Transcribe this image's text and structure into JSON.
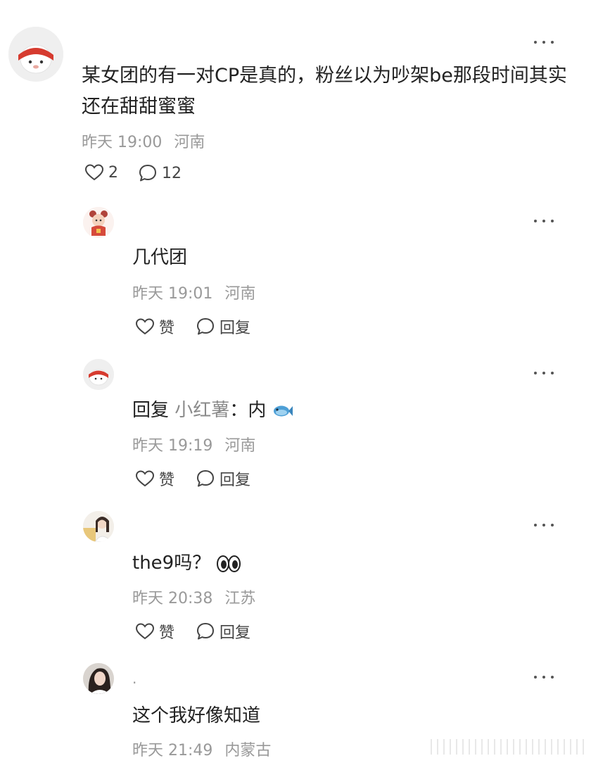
{
  "post": {
    "text": "某女团的有一对CP是真的，粉丝以为吵架be那段时间其实还在甜甜蜜蜜",
    "time": "昨天 19:00",
    "location": "河南",
    "likes": "2",
    "comments": "12"
  },
  "replies": [
    {
      "text": "几代团",
      "time": "昨天 19:01",
      "location": "河南",
      "like_label": "赞",
      "reply_label": "回复"
    },
    {
      "prefix": "回复",
      "reply_to": "小红薯",
      "separator": "：",
      "text": "内",
      "time": "昨天 19:19",
      "location": "河南",
      "like_label": "赞",
      "reply_label": "回复"
    },
    {
      "text": "the9吗？",
      "time": "昨天 20:38",
      "location": "江苏",
      "like_label": "赞",
      "reply_label": "回复"
    },
    {
      "username": ".",
      "text": "这个我好像知道",
      "time": "昨天 21:49",
      "location": "内蒙古"
    }
  ],
  "icons": {
    "more": "more-dots-icon",
    "like": "heart-outline-icon",
    "comment": "comment-bubble-icon",
    "fish": "fish-emoji",
    "eyes": "eyes-emoji"
  },
  "colors": {
    "text": "#222222",
    "meta": "#999999",
    "action": "#444444",
    "reply_to": "#8a8a8a"
  }
}
